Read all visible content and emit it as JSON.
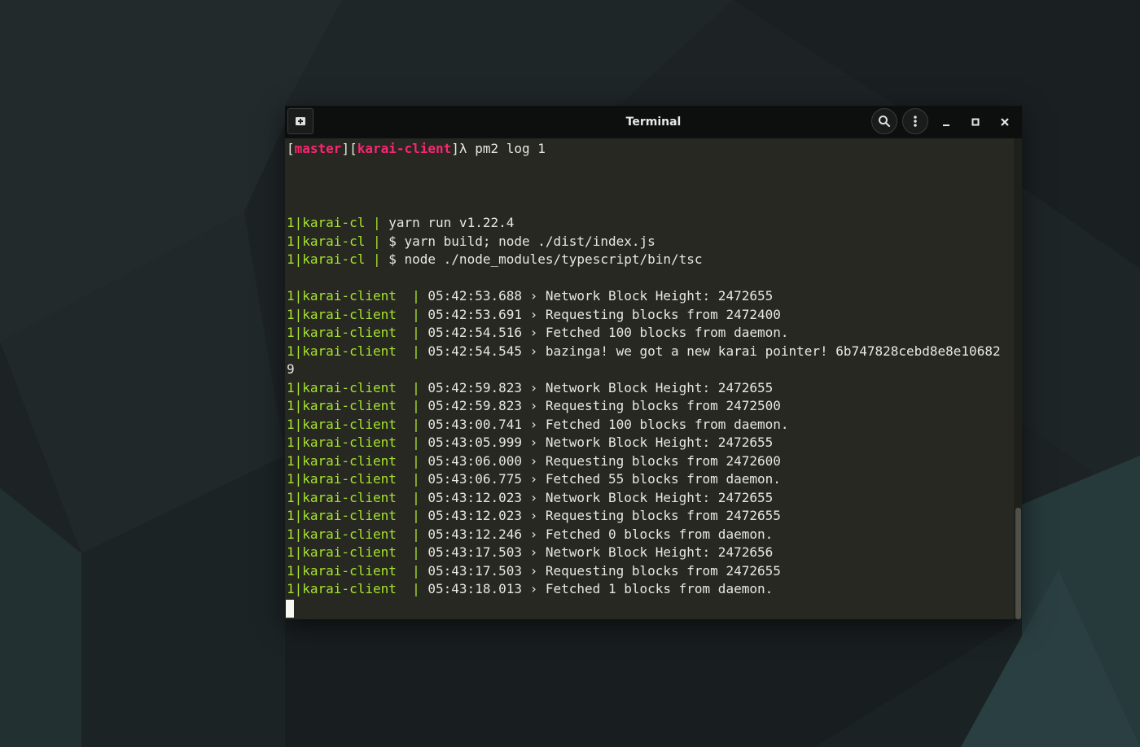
{
  "window": {
    "title": "Terminal",
    "icons": {
      "new_tab": "new-tab-icon",
      "search": "search-icon",
      "menu": "kebab-menu-icon",
      "minimize": "minimize-icon",
      "maximize": "maximize-icon",
      "close": "close-icon"
    }
  },
  "colors": {
    "terminal_bg": "#272822",
    "titlebar_bg": "#0d0e0e",
    "prompt_accent": "#f92672",
    "log_prefix": "#a6e22e",
    "text": "#e8e8e2"
  },
  "terminal": {
    "prompt": {
      "open1": "[",
      "branch": "master",
      "mid": "][",
      "dir": "karai-client",
      "close": "]λ ",
      "command": "pm2 log 1"
    },
    "yarn_lines": [
      {
        "prefix": "1|karai-cl | ",
        "text": "yarn run v1.22.4"
      },
      {
        "prefix": "1|karai-cl | ",
        "text": "$ yarn build; node ./dist/index.js"
      },
      {
        "prefix": "1|karai-cl | ",
        "text": "$ node ./node_modules/typescript/bin/tsc"
      }
    ],
    "log_prefix": "1|karai-client  | ",
    "log_lines": [
      "05:42:53.688 › Network Block Height: 2472655",
      "05:42:53.691 › Requesting blocks from 2472400",
      "05:42:54.516 › Fetched 100 blocks from daemon.",
      "05:42:54.545 › bazinga! we got a new karai pointer! 6b747828cebd8e8e10682",
      "05:42:59.823 › Network Block Height: 2472655",
      "05:42:59.823 › Requesting blocks from 2472500",
      "05:43:00.741 › Fetched 100 blocks from daemon.",
      "05:43:05.999 › Network Block Height: 2472655",
      "05:43:06.000 › Requesting blocks from 2472600",
      "05:43:06.775 › Fetched 55 blocks from daemon.",
      "05:43:12.023 › Network Block Height: 2472655",
      "05:43:12.023 › Requesting blocks from 2472655",
      "05:43:12.246 › Fetched 0 blocks from daemon.",
      "05:43:17.503 › Network Block Height: 2472656",
      "05:43:17.503 › Requesting blocks from 2472655",
      "05:43:18.013 › Fetched 1 blocks from daemon."
    ],
    "wrap_continuation": "9"
  }
}
